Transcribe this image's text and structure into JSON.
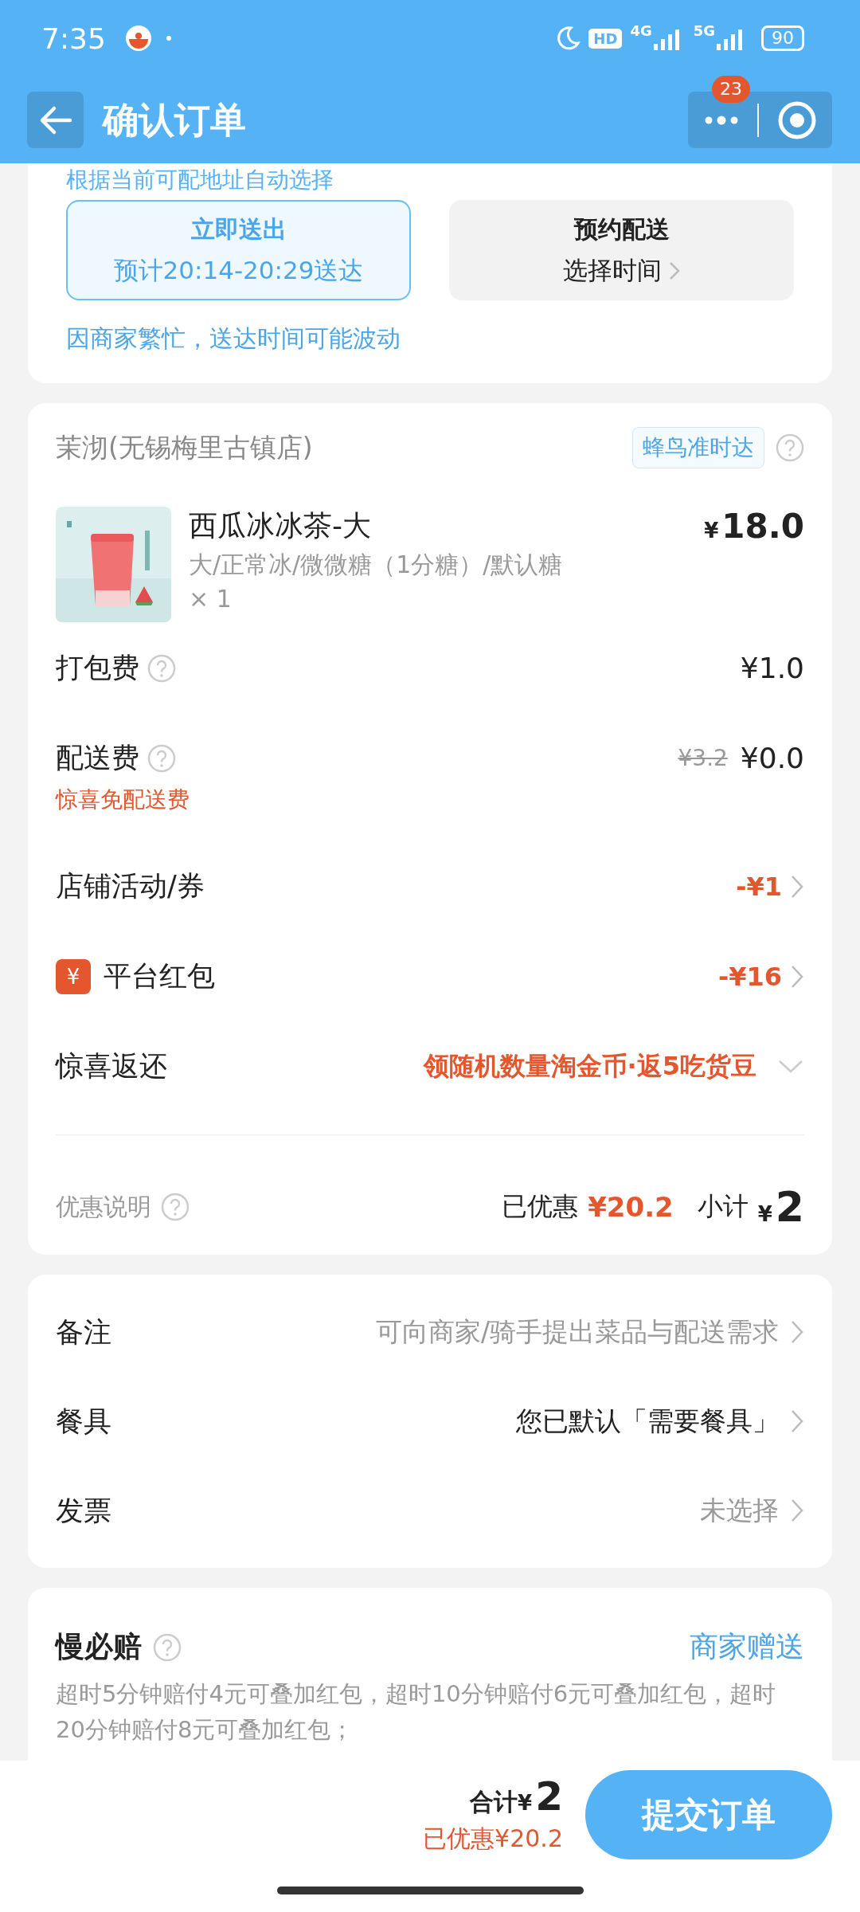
{
  "status_bar": {
    "time": "7:35",
    "hd": "HD",
    "network_1": "4G",
    "network_2": "5G",
    "battery": "90"
  },
  "header": {
    "title": "确认订单",
    "badge": "23"
  },
  "delivery": {
    "hint": "根据当前可配地址自动选择",
    "options": [
      {
        "title": "立即送出",
        "subtitle": "预计20:14-20:29送达",
        "selected": true
      },
      {
        "title": "预约配送",
        "subtitle": "选择时间",
        "selected": false
      }
    ],
    "notice": "因商家繁忙，送达时间可能波动"
  },
  "store": {
    "name": "茉沏(无锡梅里古镇店)",
    "badge": "蜂鸟准时达",
    "item": {
      "name": "西瓜冰冰茶-大",
      "specs": "大/正常冰/微微糖（1分糖）/默认糖",
      "quantity": "× 1",
      "currency": "¥",
      "price": "18.0"
    },
    "charges": [
      {
        "kind": "fee",
        "label": "打包费",
        "help": true,
        "value": "¥1.0"
      },
      {
        "kind": "fee",
        "label": "配送费",
        "help": true,
        "original_value": "¥3.2",
        "value": "¥0.0",
        "note": "惊喜免配送费"
      },
      {
        "kind": "discount",
        "label": "店铺活动/券",
        "value": "-¥1"
      },
      {
        "kind": "discount",
        "label": "平台红包",
        "icon": "¥",
        "value": "-¥16"
      },
      {
        "kind": "reward",
        "label": "惊喜返还",
        "value": "领随机数量淘金币·返5吃货豆"
      }
    ],
    "summary": {
      "label": "优惠说明",
      "saved_label": "已优惠",
      "saved": "¥20.2",
      "subtotal_label": "小计",
      "currency": "¥",
      "subtotal": "2"
    }
  },
  "options": [
    {
      "label": "备注",
      "value": "可向商家/骑手提出菜品与配送需求",
      "muted": true
    },
    {
      "label": "餐具",
      "value": "您已默认「需要餐具」",
      "muted": false
    },
    {
      "label": "发票",
      "value": "未选择",
      "muted": true
    }
  ],
  "compensation": {
    "title": "慢必赔",
    "tag": "商家赠送",
    "description": "超时5分钟赔付4元可叠加红包，超时10分钟赔付6元可叠加红包，超时20分钟赔付8元可叠加红包；"
  },
  "footer": {
    "total_label": "合计",
    "currency": "¥",
    "total": "2",
    "saved": "已优惠¥20.2",
    "submit": "提交订单"
  }
}
